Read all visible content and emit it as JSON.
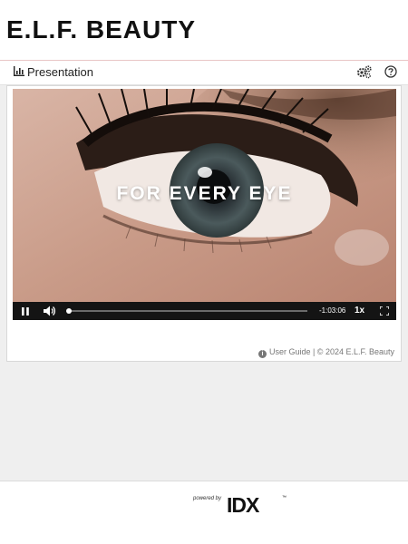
{
  "brand": {
    "logo_text": "E.L.F. BEAUTY"
  },
  "header": {
    "title": "Presentation",
    "icons": [
      "chart-icon",
      "gear-icon",
      "help-icon"
    ]
  },
  "video": {
    "caption": "FOR EVERY EYE",
    "controls": {
      "time_remaining": "-1:03:06",
      "speed": "1x",
      "progress_fraction": 0.005
    }
  },
  "footer": {
    "info_icon": "i",
    "text": "User Guide | © 2024 E.L.F. Beauty"
  },
  "powered_by": {
    "label": "powered by",
    "brand": "IDX",
    "trademark": "™"
  }
}
